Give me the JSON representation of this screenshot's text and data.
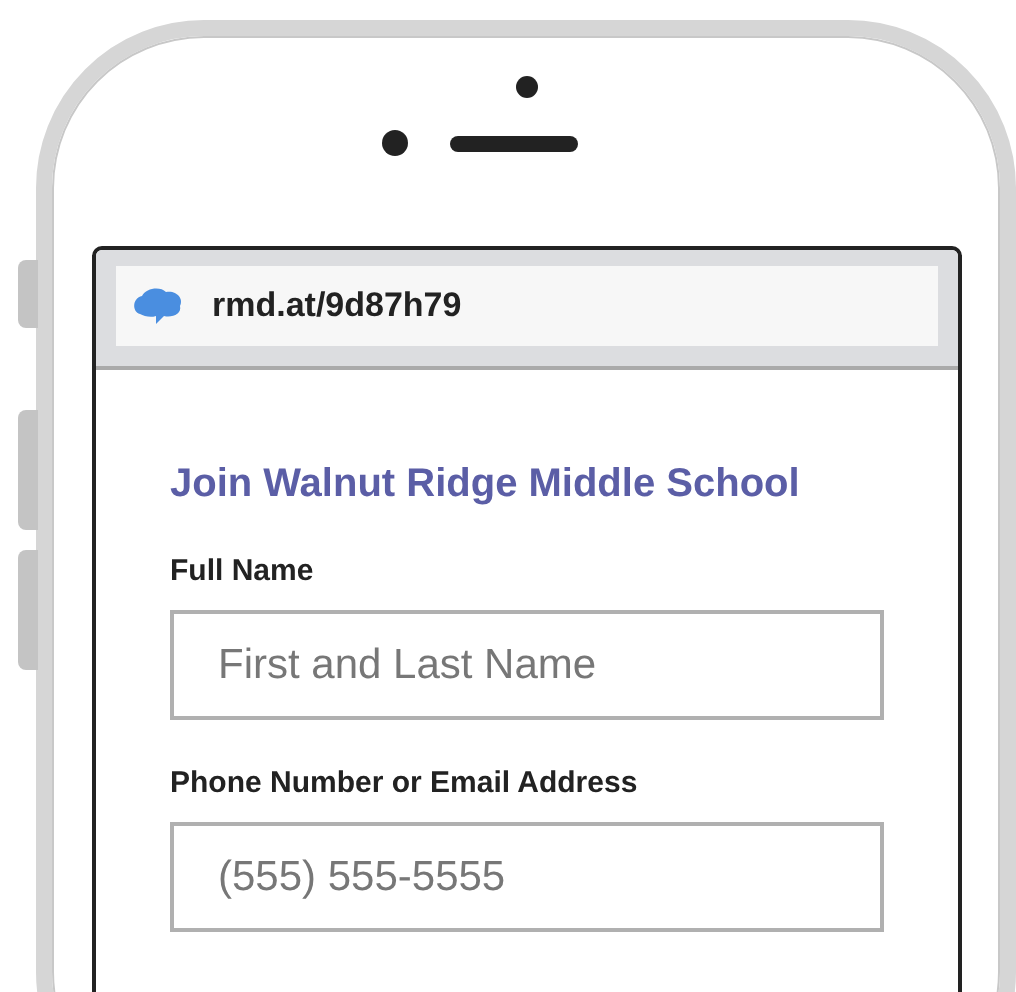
{
  "address_bar": {
    "url": "rmd.at/9d87h79"
  },
  "form": {
    "title": "Join Walnut Ridge Middle School",
    "fields": [
      {
        "label": "Full Name",
        "placeholder": "First and Last Name"
      },
      {
        "label": "Phone Number or Email Address",
        "placeholder": "(555) 555-5555"
      }
    ]
  }
}
